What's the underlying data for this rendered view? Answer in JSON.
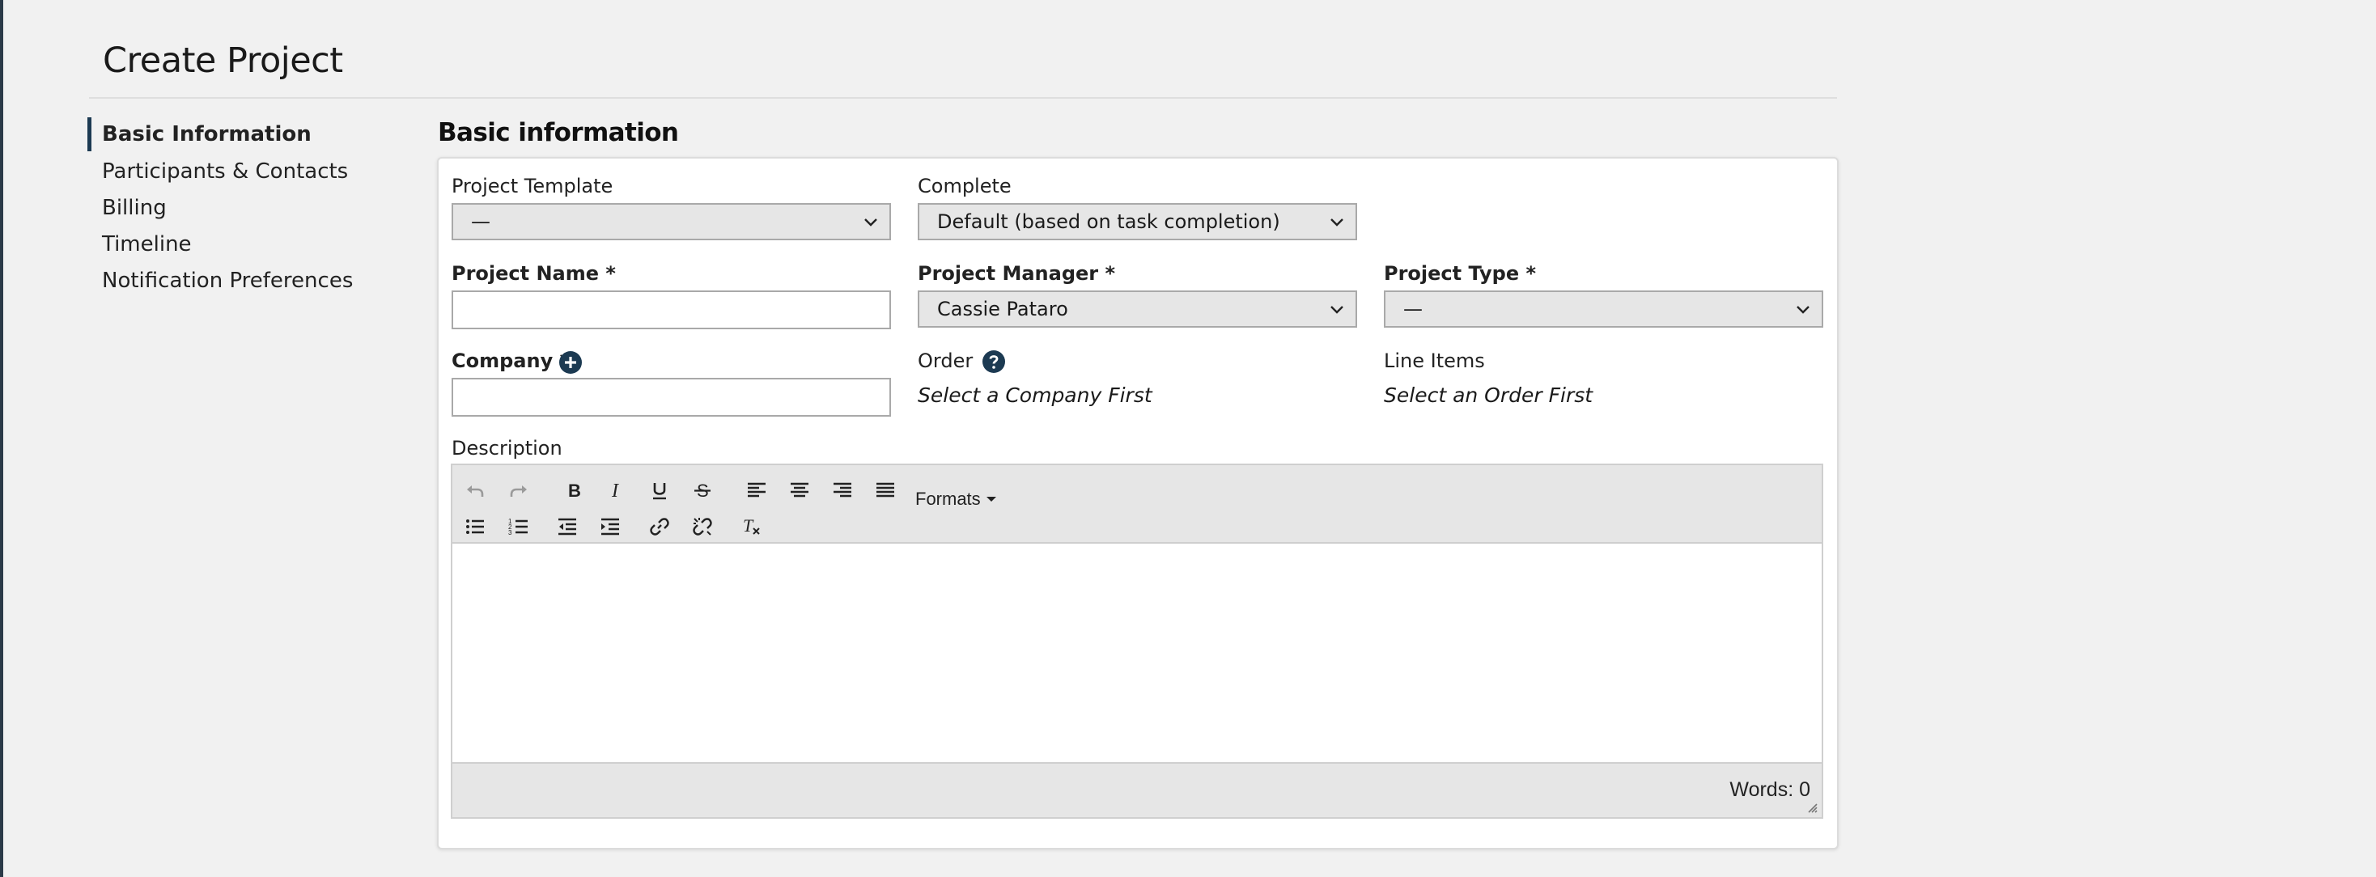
{
  "page": {
    "title": "Create Project"
  },
  "sidebar": {
    "items": [
      {
        "label": "Basic Information",
        "active": true
      },
      {
        "label": "Participants & Contacts",
        "active": false
      },
      {
        "label": "Billing",
        "active": false
      },
      {
        "label": "Timeline",
        "active": false
      },
      {
        "label": "Notification Preferences",
        "active": false
      }
    ]
  },
  "form": {
    "section_title": "Basic information",
    "project_template": {
      "label": "Project Template",
      "value": "—"
    },
    "complete": {
      "label": "Complete",
      "value": "Default (based on task completion)"
    },
    "project_name": {
      "label": "Project Name *",
      "value": "",
      "placeholder": ""
    },
    "project_manager": {
      "label": "Project Manager *",
      "value": "Cassie Pataro"
    },
    "project_type": {
      "label": "Project Type *",
      "value": "—"
    },
    "company": {
      "label": "Company *",
      "value": "",
      "placeholder": "",
      "add_icon": "plus-circle-icon"
    },
    "order": {
      "label": "Order",
      "note": "Select a Company First",
      "help_icon": "question-circle-icon"
    },
    "line_items": {
      "label": "Line Items",
      "note": "Select an Order First"
    },
    "description": {
      "label": "Description",
      "toolbar": {
        "formats_label": "Formats",
        "icons": [
          "undo-icon",
          "redo-icon",
          "bold-icon",
          "italic-icon",
          "underline-icon",
          "strikethrough-icon",
          "align-left-icon",
          "align-center-icon",
          "align-right-icon",
          "align-justify-icon",
          "bullet-list-icon",
          "numbered-list-icon",
          "outdent-icon",
          "indent-icon",
          "link-icon",
          "unlink-icon",
          "clear-formatting-icon"
        ]
      },
      "content": "",
      "word_count": "Words: 0"
    }
  },
  "colors": {
    "accent": "#1c3a52",
    "background": "#f1f1f1",
    "field_bg": "#e6e6e6"
  }
}
